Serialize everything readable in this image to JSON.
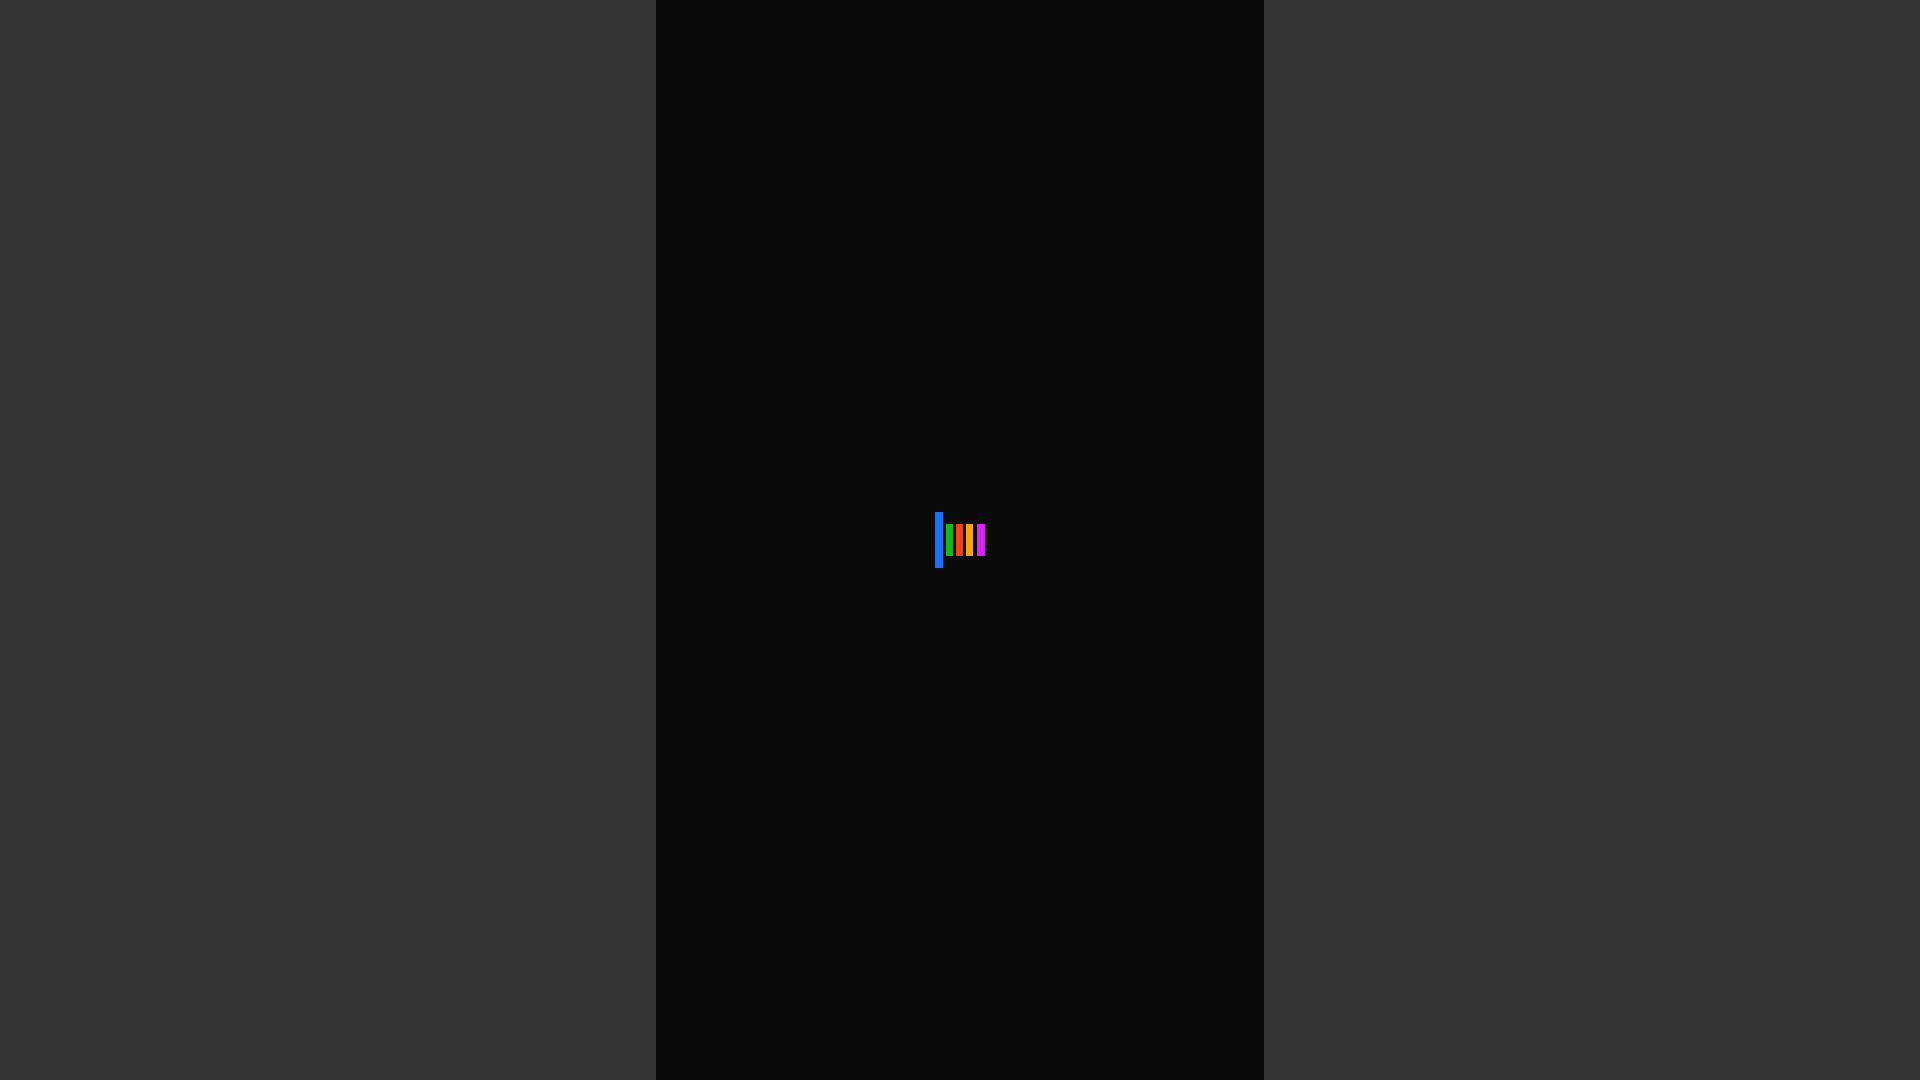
{
  "screen": {
    "background": "#0a0a0a",
    "surround_background": "#333333"
  },
  "loader": {
    "icon": "loading-bars-icon",
    "bars": [
      {
        "name": "blue",
        "color": "#1a6ff5"
      },
      {
        "name": "green",
        "color": "#17b320"
      },
      {
        "name": "red",
        "color": "#e8461f"
      },
      {
        "name": "orange",
        "color": "#f5a419"
      },
      {
        "name": "magenta",
        "color": "#d626f2"
      }
    ]
  }
}
